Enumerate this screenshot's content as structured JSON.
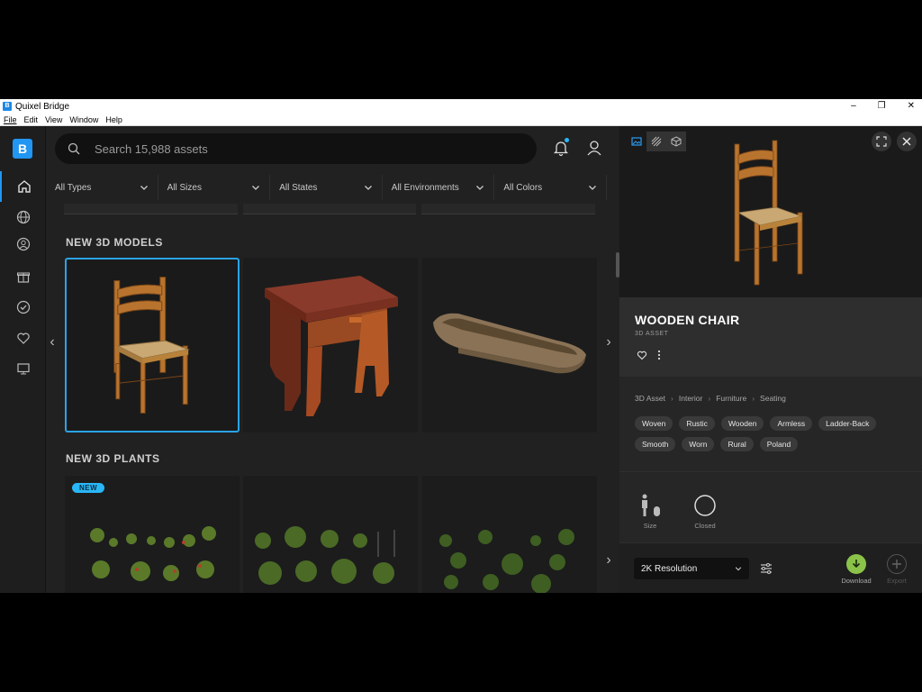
{
  "window": {
    "title": "Quixel Bridge",
    "controls": [
      "–",
      "❐",
      "✕"
    ]
  },
  "menu": [
    "File",
    "Edit",
    "View",
    "Window",
    "Help"
  ],
  "rail": {
    "logo": "B",
    "items": [
      "home-icon",
      "globe-icon",
      "user-circle-icon",
      "gift-icon",
      "check-circle-icon",
      "heart-icon",
      "monitor-icon"
    ]
  },
  "search": {
    "placeholder": "Search 15,988 assets",
    "value": ""
  },
  "filters": [
    "All Types",
    "All Sizes",
    "All States",
    "All Environments",
    "All Colors"
  ],
  "sections": {
    "models": {
      "title": "NEW 3D MODELS",
      "items": [
        "Wooden Chair",
        "Wooden Table",
        "Wooden Trough"
      ]
    },
    "plants": {
      "title": "NEW 3D PLANTS",
      "badge": "NEW"
    }
  },
  "asset": {
    "title": "WOODEN CHAIR",
    "subtitle": "3D ASSET",
    "breadcrumb": [
      "3D Asset",
      "Interior",
      "Furniture",
      "Seating"
    ],
    "tags": [
      "Woven",
      "Rustic",
      "Wooden",
      "Armless",
      "Ladder-Back",
      "Smooth",
      "Worn",
      "Rural",
      "Poland"
    ],
    "attributes": [
      {
        "label": "Size",
        "icon": "size-icon"
      },
      {
        "label": "Closed",
        "icon": "closed-circle-icon"
      }
    ],
    "resolution": "2K Resolution",
    "download_label": "Download",
    "export_label": "Export"
  },
  "colors": {
    "accent": "#2196f3",
    "selected_border": "#2aa3e8",
    "download": "#8bc34a",
    "badge": "#29b6f6"
  }
}
